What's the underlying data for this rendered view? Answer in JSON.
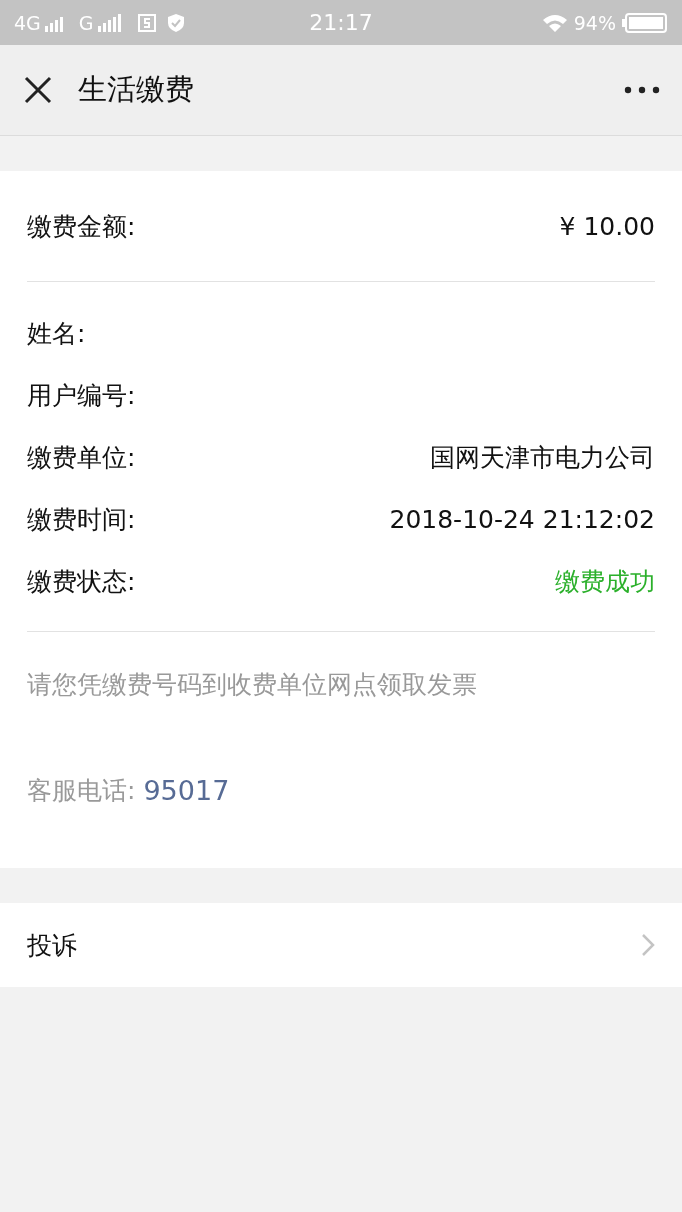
{
  "status_bar": {
    "network_1": "4G",
    "network_2": "G",
    "time": "21:17",
    "battery": "94%"
  },
  "nav": {
    "title": "生活缴费"
  },
  "payment": {
    "amount": {
      "label": "缴费金额:",
      "value": "¥ 10.00"
    },
    "rows": [
      {
        "label": "姓名:",
        "kind": "text"
      },
      {
        "label": "用户编号:",
        "kind": "text"
      },
      {
        "label": "缴费单位:",
        "value": "国网天津市电力公司",
        "kind": "text"
      },
      {
        "label": "缴费时间:",
        "value": "2018-10-24 21:12:02",
        "kind": "text"
      },
      {
        "label": "缴费状态:",
        "value": "缴费成功",
        "kind": "status"
      }
    ],
    "note": "请您凭缴费号码到收费单位网点领取发票",
    "hotline": {
      "label": "客服电话:",
      "number": "95017"
    }
  },
  "complaint": {
    "label": "投诉"
  }
}
